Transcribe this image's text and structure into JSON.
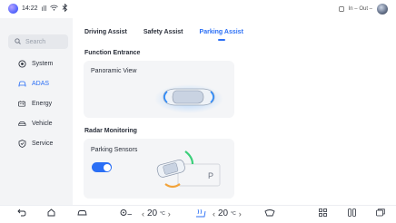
{
  "status_bar": {
    "time": "14:22",
    "signal": "ᵀ⁴ᴳ",
    "wifi_glyph": "≈",
    "bluetooth_glyph": "✱",
    "user_status": "In – Out –"
  },
  "sidebar": {
    "search_placeholder": "Search",
    "items": [
      {
        "label": "System",
        "icon": "gear-icon"
      },
      {
        "label": "ADAS",
        "icon": "car-front-icon",
        "active": true
      },
      {
        "label": "Energy",
        "icon": "battery-icon"
      },
      {
        "label": "Vehicle",
        "icon": "car-side-icon"
      },
      {
        "label": "Service",
        "icon": "shield-icon"
      }
    ]
  },
  "tabs": [
    {
      "label": "Driving Assist"
    },
    {
      "label": "Safety Assist"
    },
    {
      "label": "Parking Assist",
      "active": true
    }
  ],
  "sections": {
    "function_entrance": "Function Entrance",
    "radar_monitoring": "Radar Monitoring"
  },
  "cards": {
    "panoramic_view": "Panoramic View",
    "parking_sensors": "Parking Sensors",
    "parking_toggle_on": true,
    "parking_slot_label": "P"
  },
  "dock": {
    "left_temp": "20",
    "right_temp": "20",
    "temp_unit": "°C"
  },
  "colors": {
    "accent": "#2b6ff5",
    "sidebar_bg": "#f3f4f6",
    "card_bg": "#f4f5f7",
    "radar_green": "#3ccf7a",
    "radar_orange": "#f2a33a"
  }
}
